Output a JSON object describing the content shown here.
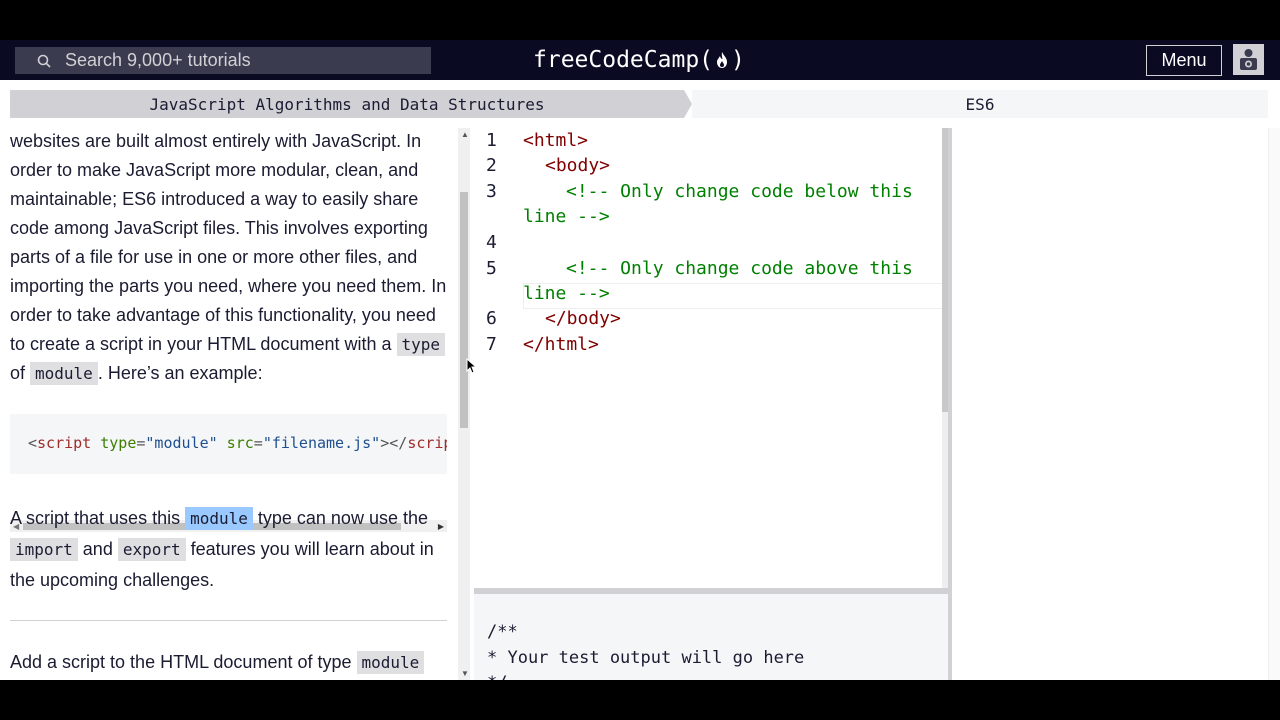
{
  "nav": {
    "search_placeholder": "Search 9,000+ tutorials",
    "brand_left": "freeCodeCamp(",
    "brand_right": ")",
    "menu_label": "Menu"
  },
  "breadcrumb": {
    "main": "JavaScript Algorithms and Data Structures",
    "sub": "ES6"
  },
  "instructions": {
    "p1_a": "websites are built almost entirely with JavaScript. In order to make JavaScript more modular, clean, and maintainable; ES6 introduced a way to easily share code among JavaScript files. This involves exporting parts of a file for use in one or more other files, and importing the parts you need, where you need them. In order to take advantage of this functionality, you need to create a script in your HTML document with a ",
    "p1_code1": "type",
    "p1_b": " of ",
    "p1_code2": "module",
    "p1_c": ". Here’s an example:",
    "example": {
      "lt": "<",
      "tag": "script",
      "attr1": " type",
      "eq1": "=",
      "val1": "\"module\"",
      "attr2": " src",
      "eq2": "=",
      "val2": "\"filename.js\"",
      "close": "></",
      "tag_end": "script",
      "gt": ">"
    },
    "p2_a": "A script that uses this ",
    "p2_code1": "module",
    "p2_b": " type can now use the ",
    "p2_code2": "import",
    "p2_c": " and ",
    "p2_code3": "export",
    "p2_d": " features you will learn about in the upcoming challenges.",
    "p3_a": "Add a script to the HTML document of type ",
    "p3_code": "module"
  },
  "editor": {
    "line_numbers": [
      "1",
      "2",
      "3",
      "4",
      "5",
      "6",
      "7"
    ],
    "l1": "<html>",
    "l2": "<body>",
    "l3a": "<!-- Only change code below this",
    "l3b": "line -->",
    "l5a": "<!-- Only change code above this",
    "l5b": "line -->",
    "l6": "</body>",
    "l7": "</html>"
  },
  "console": {
    "output": "/**\n* Your test output will go here\n*/"
  },
  "colors": {
    "nav_bg": "#0a0a23",
    "tag": "#800000",
    "comment": "#008000",
    "highlight": "#99c9ff"
  }
}
